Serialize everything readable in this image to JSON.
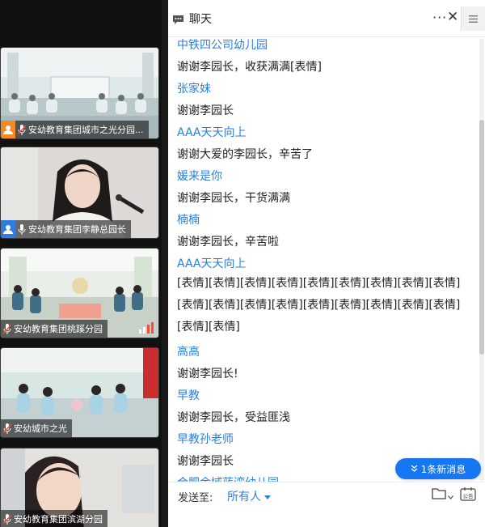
{
  "video_tiles": [
    {
      "label": "安幼教育集团城市之光分园...",
      "avatar_color": "#f08a24"
    },
    {
      "label": "安幼教育集团李静总园长",
      "avatar_color": "#2f7de1"
    },
    {
      "label": "安幼教育集团桃蹊分园"
    },
    {
      "label": "安幼城市之光"
    },
    {
      "label": "安幼教育集团滨湖分园"
    }
  ],
  "chat": {
    "title": "聊天",
    "more_label": "···",
    "close_label": "✕",
    "messages": [
      {
        "sender": "中铁四公司幼儿园",
        "text": "谢谢李园长，收获满满[表情]"
      },
      {
        "sender": "张家妹",
        "text": "谢谢李园长"
      },
      {
        "sender": "AAA天天向上",
        "text": "谢谢大爱的李园长，辛苦了"
      },
      {
        "sender": "媛来是你",
        "text": "谢谢李园长，干货满满"
      },
      {
        "sender": "楠楠",
        "text": "谢谢李园长，辛苦啦"
      },
      {
        "sender": "AAA天天向上",
        "text": "[表情][表情][表情][表情][表情][表情][表情][表情][表情][表情][表情][表情][表情][表情][表情][表情][表情][表情][表情][表情]"
      },
      {
        "sender": "高高",
        "text": "谢谢李园长!"
      },
      {
        "sender": "早教",
        "text": "谢谢李园长，受益匪浅"
      },
      {
        "sender": "早教孙老师",
        "text": "谢谢李园长"
      },
      {
        "sender": "合肥金域蓝湾幼儿园",
        "text": ""
      }
    ],
    "new_messages_label": "1条新消息",
    "send_to_label": "发送至:",
    "recipient": "所有人",
    "notice_label": "公告"
  },
  "colors": {
    "accent": "#1677f2",
    "sender": "#2a7fdc"
  }
}
